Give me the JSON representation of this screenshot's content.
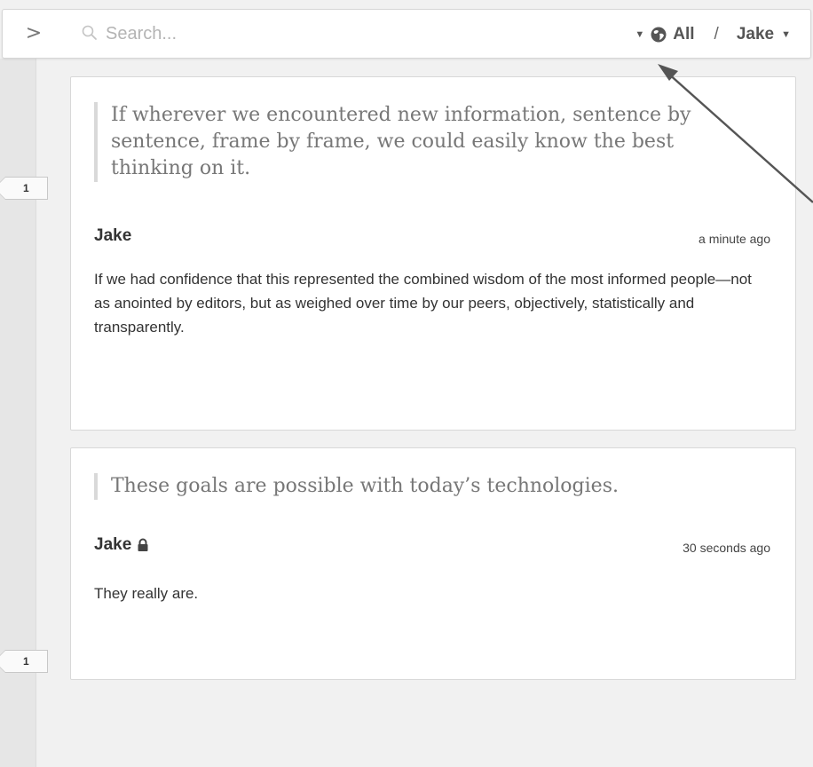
{
  "toolbar": {
    "collapse_label": ">",
    "search_placeholder": "Search...",
    "scope_label": "All",
    "scope_separator": "/",
    "user_label": "Jake"
  },
  "annotations": [
    {
      "count": "1",
      "quote": "If wherever we encountered new information, sentence by sentence, frame by frame, we could easily know the best thinking on it.",
      "author": "Jake",
      "timestamp": "a minute ago",
      "text": "If we had confidence that this represented the combined wisdom of the most informed people—not as anointed by editors, but as weighed over time by our peers, objectively, statistically and transparently.",
      "private": false
    },
    {
      "count": "1",
      "quote": "These goals are possible with today’s technologies.",
      "author": "Jake",
      "timestamp": "30 seconds ago",
      "text": "They really are.",
      "private": true
    }
  ],
  "icons": {
    "search": "search-icon",
    "globe": "globe-icon",
    "lock": "lock-icon"
  },
  "colors": {
    "background": "#f1f1f1",
    "card": "#ffffff",
    "quote_text": "#777777",
    "arrow": "#555555"
  }
}
